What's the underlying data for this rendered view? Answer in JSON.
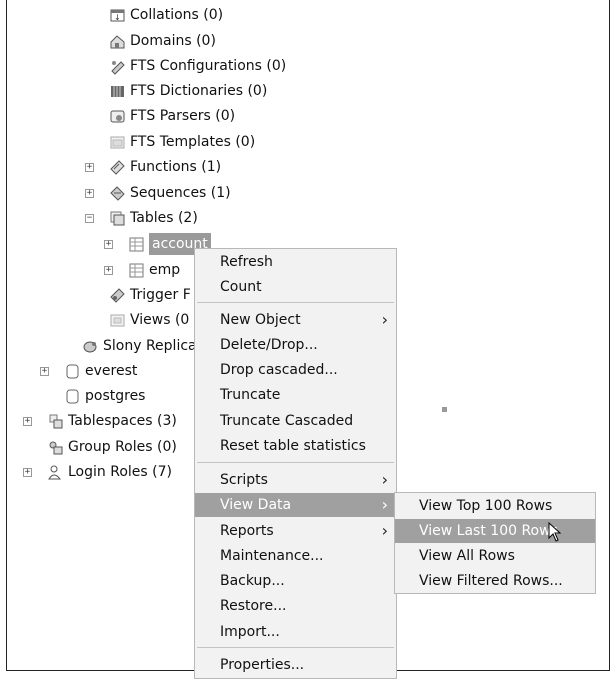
{
  "tree": [
    {
      "label": "Collations (0)",
      "icon": "collations-icon",
      "expander": ""
    },
    {
      "label": "Domains (0)",
      "icon": "domains-icon",
      "expander": ""
    },
    {
      "label": "FTS Configurations (0)",
      "icon": "fts-config-icon",
      "expander": ""
    },
    {
      "label": "FTS Dictionaries (0)",
      "icon": "fts-dict-icon",
      "expander": ""
    },
    {
      "label": "FTS Parsers (0)",
      "icon": "fts-parser-icon",
      "expander": ""
    },
    {
      "label": "FTS Templates (0)",
      "icon": "fts-template-icon",
      "expander": ""
    },
    {
      "label": "Functions (1)",
      "icon": "functions-icon",
      "expander": "+"
    },
    {
      "label": "Sequences (1)",
      "icon": "sequences-icon",
      "expander": "+"
    },
    {
      "label": "Tables (2)",
      "icon": "tables-icon",
      "expander": "−"
    },
    {
      "label": "account",
      "icon": "table-icon",
      "expander": "+",
      "selected": true
    },
    {
      "label": "emp",
      "icon": "table-icon",
      "expander": "+"
    },
    {
      "label": "Trigger F",
      "icon": "trigger-functions-icon",
      "expander": ""
    },
    {
      "label": "Views (0",
      "icon": "views-icon",
      "expander": ""
    },
    {
      "label": "Slony Replica",
      "icon": "slony-icon",
      "expander": ""
    },
    {
      "label": "everest",
      "icon": "database-icon",
      "expander": "+"
    },
    {
      "label": "postgres",
      "icon": "database-icon",
      "expander": ""
    },
    {
      "label": "Tablespaces (3)",
      "icon": "tablespaces-icon",
      "expander": "+"
    },
    {
      "label": "Group Roles (0)",
      "icon": "group-roles-icon",
      "expander": ""
    },
    {
      "label": "Login Roles (7)",
      "icon": "login-roles-icon",
      "expander": "+"
    }
  ],
  "menu": {
    "refresh": "Refresh",
    "count": "Count",
    "new_object": "New Object",
    "delete_drop": "Delete/Drop...",
    "drop_cascaded": "Drop cascaded...",
    "truncate": "Truncate",
    "truncate_cascaded": "Truncate Cascaded",
    "reset_stats": "Reset table statistics",
    "scripts": "Scripts",
    "view_data": "View Data",
    "reports": "Reports",
    "maintenance": "Maintenance...",
    "backup": "Backup...",
    "restore": "Restore...",
    "import": "Import...",
    "properties": "Properties...",
    "submenu_arrow": "›"
  },
  "submenu": {
    "top100": "View Top 100 Rows",
    "last100": "View Last 100 Rows",
    "all": "View All Rows",
    "filtered": "View Filtered Rows..."
  },
  "colors": {
    "highlight": "#a0a0a0",
    "menu_bg": "#f2f2f2"
  }
}
